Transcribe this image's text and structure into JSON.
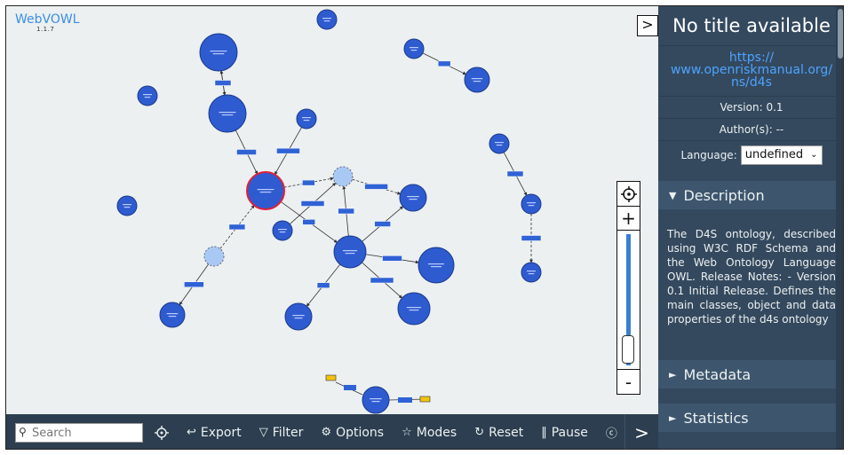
{
  "app": {
    "name": "WebVOWL",
    "version": "1.1.7"
  },
  "toolbar": {
    "search_placeholder": "Search",
    "export": "Export",
    "filter": "Filter",
    "options": "Options",
    "modes": "Modes",
    "reset": "Reset",
    "pause": "Pause"
  },
  "sidebar": {
    "title": "No title available",
    "iri": "https://\nwww.openriskmanual.org/\nns/d4s",
    "version": "Version: 0.1",
    "authors": "Author(s): --",
    "language_label": "Language:",
    "language_value": "undefined",
    "sections": {
      "description": "Description",
      "metadata": "Metadata",
      "statistics": "Statistics"
    },
    "description_text": "The D4S ontology, described using W3C RDF Schema and the Web Ontology Language OWL. Release Notes: - Version 0.1 Initial Release. Defines the main classes, object and data properties of the d4s ontology"
  },
  "colors": {
    "class_fill": "#2f5bd0",
    "class_stroke": "#1a3a8a",
    "external_fill": "#a9c9f5",
    "selected_stroke": "#e0203a",
    "property_fill": "#3062d6",
    "datatype_fill": "#f2c40f",
    "toolbar_bg": "#2c3e50",
    "sidebar_bg": "#34495e",
    "link": "#4da3ff"
  }
}
